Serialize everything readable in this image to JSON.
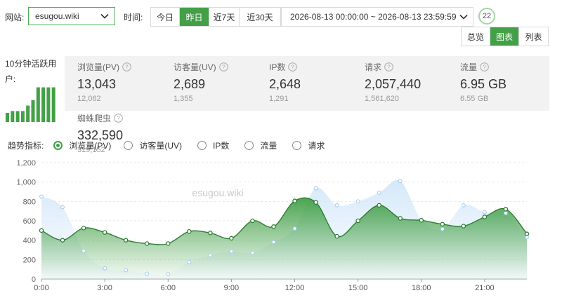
{
  "toolbar": {
    "site_label": "网站:",
    "site_value": "esugou.wiki",
    "time_label": "时间:",
    "quick_ranges": [
      {
        "label": "今日",
        "active": false
      },
      {
        "label": "昨日",
        "active": true
      },
      {
        "label": "近7天",
        "active": false
      },
      {
        "label": "近30天",
        "active": false
      }
    ],
    "date_range": "2026-08-13 00:00:00 ~ 2026-08-13 23:59:59",
    "refresh_countdown": "22"
  },
  "views": [
    {
      "label": "总览",
      "active": false
    },
    {
      "label": "图表",
      "active": true
    },
    {
      "label": "列表",
      "active": false
    }
  ],
  "active_users": {
    "title": "10分钟活跃用户:",
    "bars": [
      0.25,
      0.3,
      0.3,
      0.3,
      0.45,
      0.6,
      0.95,
      0.95,
      0.95,
      0.95
    ]
  },
  "stats": [
    {
      "name": "浏览量(PV)",
      "value": "13,043",
      "prev": "12,062"
    },
    {
      "name": "访客量(UV)",
      "value": "2,689",
      "prev": "1,355"
    },
    {
      "name": "IP数",
      "value": "2,648",
      "prev": "1,291"
    },
    {
      "name": "请求",
      "value": "2,057,440",
      "prev": "1,561,620"
    },
    {
      "name": "流量",
      "value": "6.95 GB",
      "prev": "6.55 GB"
    },
    {
      "name": "蜘蛛爬虫",
      "value": "332,590",
      "prev": "319,152"
    }
  ],
  "trend": {
    "label": "趋势指标:",
    "options": [
      {
        "label": "浏览量(PV)",
        "selected": true
      },
      {
        "label": "访客量(UV)",
        "selected": false
      },
      {
        "label": "IP数",
        "selected": false
      },
      {
        "label": "流量",
        "selected": false
      },
      {
        "label": "请求",
        "selected": false
      }
    ]
  },
  "colors": {
    "accent": "#43a047",
    "compare": "#bcdcf5"
  },
  "chart_data": {
    "type": "area",
    "watermark": "esugou.wiki",
    "x": [
      0,
      1,
      2,
      3,
      4,
      5,
      6,
      7,
      8,
      9,
      10,
      11,
      12,
      13,
      14,
      15,
      16,
      17,
      18,
      19,
      20,
      21,
      22,
      23
    ],
    "x_ticks": [
      {
        "v": 0,
        "label": "0:00"
      },
      {
        "v": 3,
        "label": "3:00"
      },
      {
        "v": 6,
        "label": "6:00"
      },
      {
        "v": 9,
        "label": "9:00"
      },
      {
        "v": 12,
        "label": "12:00"
      },
      {
        "v": 15,
        "label": "15:00"
      },
      {
        "v": 18,
        "label": "18:00"
      },
      {
        "v": 21,
        "label": "21:00"
      }
    ],
    "ylim": [
      0,
      1200
    ],
    "y_ticks": [
      0,
      200,
      400,
      600,
      800,
      1000,
      1200
    ],
    "y_tick_labels": [
      "0",
      "200",
      "400",
      "600",
      "800",
      "1,000",
      "1,200"
    ],
    "grid": true,
    "series": [
      {
        "values": [
          500,
          400,
          525,
          480,
          400,
          365,
          365,
          490,
          475,
          420,
          600,
          540,
          805,
          790,
          440,
          600,
          760,
          625,
          605,
          565,
          545,
          640,
          720,
          465
        ]
      },
      {
        "values": [
          850,
          740,
          290,
          110,
          90,
          55,
          50,
          175,
          245,
          285,
          270,
          380,
          520,
          935,
          760,
          800,
          890,
          1010,
          610,
          515,
          760,
          690,
          680,
          430
        ]
      }
    ]
  }
}
